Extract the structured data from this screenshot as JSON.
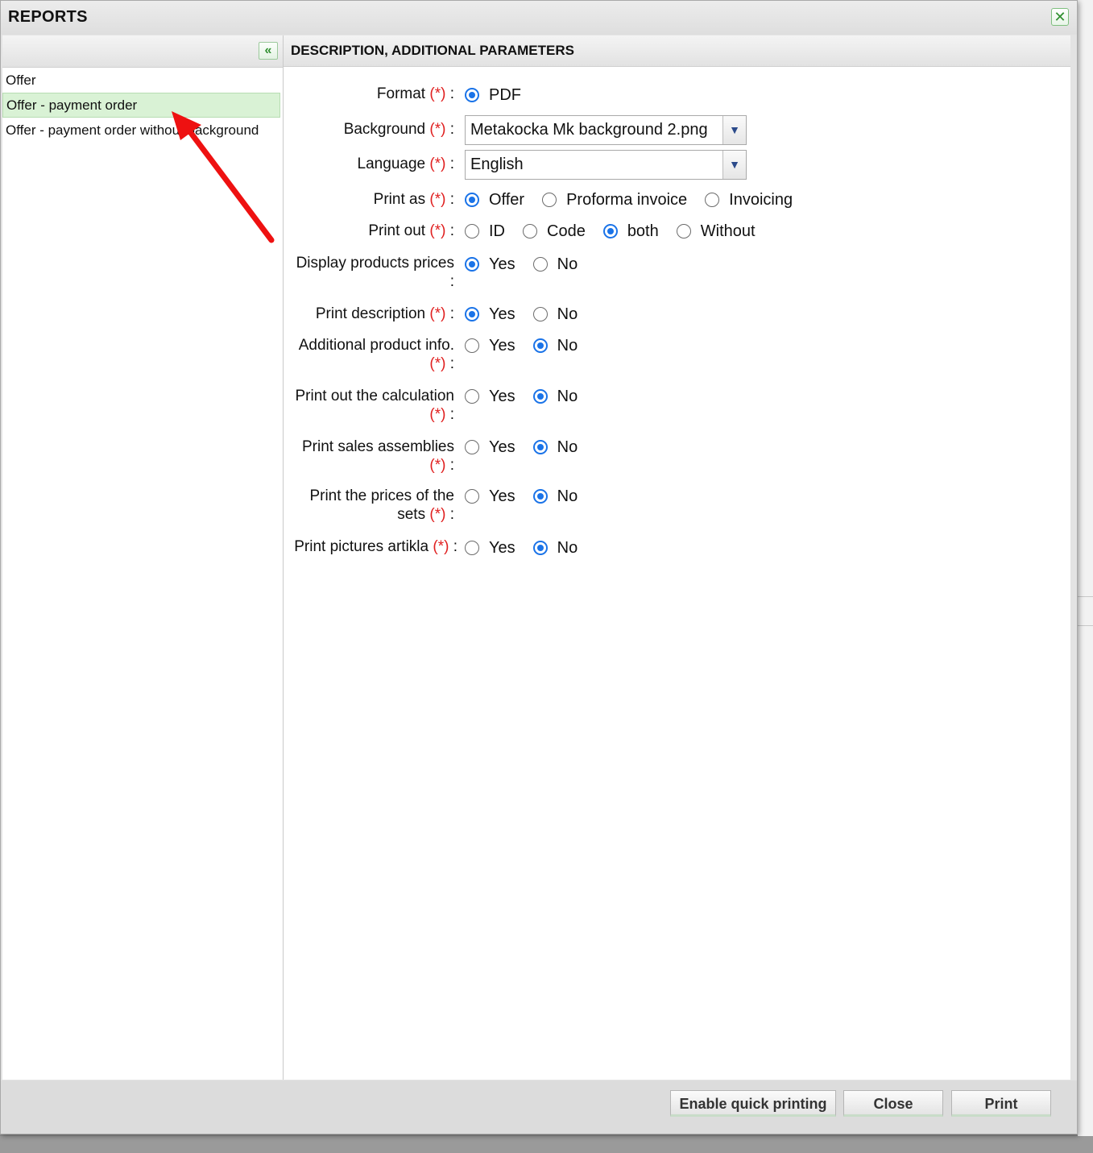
{
  "window": {
    "title": "REPORTS"
  },
  "left_panel": {
    "reports": [
      {
        "label": "Offer",
        "selected": false
      },
      {
        "label": "Offer - payment order",
        "selected": true
      },
      {
        "label": "Offer - payment order without background",
        "selected": false
      }
    ]
  },
  "right_panel": {
    "header": "DESCRIPTION, ADDITIONAL PARAMETERS",
    "required_mark": "(*)",
    "fields": {
      "format": {
        "label": "Format",
        "options": [
          "PDF"
        ],
        "selected": "PDF"
      },
      "background": {
        "label": "Background",
        "value": "Metakocka Mk background 2.png"
      },
      "language": {
        "label": "Language",
        "value": "English"
      },
      "print_as": {
        "label": "Print as",
        "options": [
          "Offer",
          "Proforma invoice",
          "Invoicing"
        ],
        "selected": "Offer"
      },
      "print_out": {
        "label": "Print out",
        "options": [
          "ID",
          "Code",
          "both",
          "Without"
        ],
        "selected": "both"
      },
      "display_products_prices": {
        "label": "Display products prices",
        "options": [
          "Yes",
          "No"
        ],
        "selected": "Yes"
      },
      "print_description": {
        "label": "Print description",
        "options": [
          "Yes",
          "No"
        ],
        "selected": "Yes"
      },
      "additional_product_info": {
        "label": "Additional product info.",
        "options": [
          "Yes",
          "No"
        ],
        "selected": "No"
      },
      "print_calculation": {
        "label": "Print out the calculation",
        "options": [
          "Yes",
          "No"
        ],
        "selected": "No"
      },
      "print_sales_assemblies": {
        "label": "Print sales assemblies",
        "options": [
          "Yes",
          "No"
        ],
        "selected": "No"
      },
      "print_set_prices": {
        "label": "Print the prices of the sets",
        "options": [
          "Yes",
          "No"
        ],
        "selected": "No"
      },
      "print_pictures": {
        "label": "Print pictures artikla",
        "options": [
          "Yes",
          "No"
        ],
        "selected": "No"
      }
    }
  },
  "footer": {
    "quick_print_label": "Enable quick printing",
    "close_label": "Close",
    "print_label": "Print"
  },
  "colors": {
    "accent": "#1a73e8",
    "required": "#e02020",
    "selected_row": "#d9f2d5",
    "annotation_arrow": "#ee1111"
  }
}
